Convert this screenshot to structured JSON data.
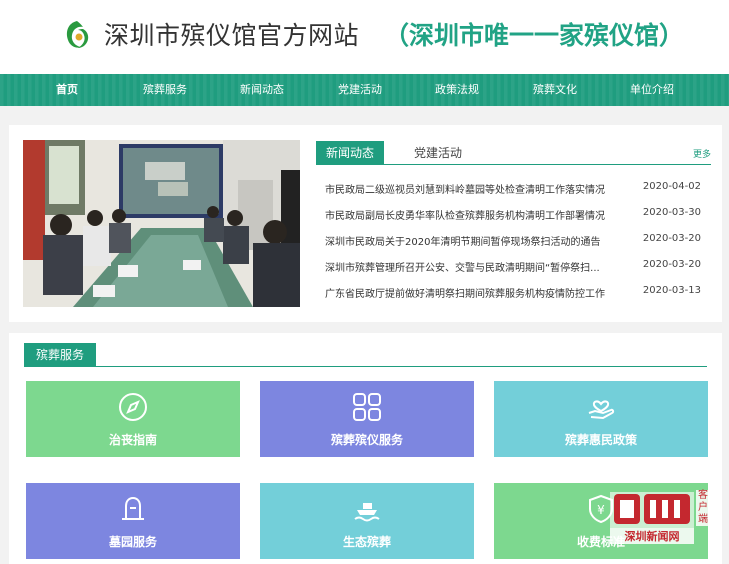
{
  "header": {
    "title": "深圳市殡仪馆官方网站",
    "slogan": "（深圳市唯一一家殡仪馆）"
  },
  "nav": {
    "items": [
      {
        "label": "首页",
        "active": true
      },
      {
        "label": "殡葬服务"
      },
      {
        "label": "新闻动态"
      },
      {
        "label": "党建活动"
      },
      {
        "label": "政策法规"
      },
      {
        "label": "殡葬文化"
      },
      {
        "label": "单位介绍"
      }
    ]
  },
  "news": {
    "tabs": [
      "新闻动态",
      "党建活动"
    ],
    "more": "更多",
    "items": [
      {
        "title": "市民政局二级巡视员刘慧到料岭墓园等处检查清明工作落实情况",
        "date": "2020-04-02"
      },
      {
        "title": "市民政局副局长皮勇华率队检查殡葬服务机构清明工作部署情况",
        "date": "2020-03-30"
      },
      {
        "title": "深圳市民政局关于2020年清明节期间暂停现场祭扫活动的通告",
        "date": "2020-03-20"
      },
      {
        "title": "深圳市殡葬管理所召开公安、交警与民政清明期间“暂停祭扫...",
        "date": "2020-03-20"
      },
      {
        "title": "广东省民政厅提前做好清明祭扫期间殡葬服务机构疫情防控工作",
        "date": "2020-03-13"
      }
    ]
  },
  "services": {
    "heading": "殡葬服务",
    "cards": [
      {
        "label": "治丧指南",
        "icon": "compass-icon",
        "color": "#7dd88f"
      },
      {
        "label": "殡葬殡仪服务",
        "icon": "grid-icon",
        "color": "#7d86e0"
      },
      {
        "label": "殡葬惠民政策",
        "icon": "hand-heart-icon",
        "color": "#73cfd9"
      },
      {
        "label": "墓园服务",
        "icon": "bell-icon",
        "color": "#7d86e0"
      },
      {
        "label": "生态殡葬",
        "icon": "boat-icon",
        "color": "#73cfd9"
      },
      {
        "label": "收费标准",
        "icon": "yuan-shield-icon",
        "color": "#7dd88f"
      }
    ]
  },
  "watermark": {
    "text": "深圳新闻网",
    "side": "客户端"
  }
}
